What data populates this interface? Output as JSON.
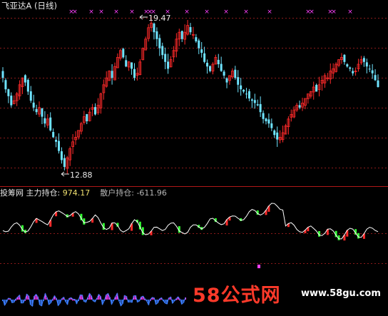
{
  "window": {
    "title": "飞亚达A (日线)"
  },
  "price_panel": {
    "high_label": "19.47",
    "low_label": "12.88",
    "colors": {
      "up": "#ff2a2a",
      "down": "#6fe4ff",
      "marker": "#ff40ff",
      "grid": "#8a1a1a",
      "line": "#ffffff"
    }
  },
  "indicator": {
    "name": "投筹网",
    "main_label": "主力持仓:",
    "main_value": "974.17",
    "retail_label": "散户持仓:",
    "retail_value": "-611.96",
    "colors": {
      "main_up": "#ff2a2a",
      "main_down": "#33ff33",
      "retail_up": "#ff40ff",
      "retail_down": "#3a7dff"
    }
  },
  "watermark": {
    "brand": "58公式网",
    "url": "www.58gu.com"
  },
  "chart_data": {
    "type": "candlestick",
    "title": "飞亚达A (日线)",
    "labeled_points": [
      {
        "label": "high",
        "value": 19.47
      },
      {
        "label": "low",
        "value": 12.88
      }
    ],
    "ylim": [
      12.5,
      20.0
    ],
    "close": [
      16.9,
      16.4,
      16.1,
      15.7,
      15.9,
      16.2,
      16.6,
      16.9,
      16.7,
      16.3,
      15.9,
      15.6,
      15.4,
      15.6,
      15.2,
      14.9,
      15.1,
      14.6,
      14.3,
      14.1,
      13.7,
      13.3,
      13.0,
      13.4,
      13.8,
      14.1,
      14.3,
      14.6,
      14.9,
      15.2,
      15.0,
      15.4,
      15.6,
      15.3,
      15.7,
      16.2,
      16.6,
      16.9,
      17.2,
      16.9,
      17.4,
      17.8,
      18.1,
      17.8,
      17.4,
      17.6,
      17.3,
      16.9,
      17.1,
      17.6,
      18.2,
      18.6,
      19.1,
      19.3,
      18.9,
      18.6,
      18.2,
      17.9,
      17.6,
      17.3,
      17.7,
      18.1,
      18.6,
      18.9,
      18.6,
      18.9,
      19.2,
      18.9,
      18.8,
      18.5,
      18.2,
      18.0,
      17.6,
      17.4,
      17.2,
      17.5,
      17.8,
      17.5,
      17.2,
      17.0,
      16.7,
      17.0,
      17.2,
      16.9,
      16.6,
      16.4,
      16.3,
      16.2,
      16.0,
      15.9,
      15.8,
      15.7,
      15.4,
      15.1,
      15.0,
      14.9,
      14.7,
      14.4,
      14.2,
      14.3,
      14.5,
      14.8,
      15.1,
      15.3,
      15.5,
      15.7,
      15.6,
      15.8,
      16.0,
      16.2,
      16.3,
      16.5,
      16.3,
      16.6,
      16.8,
      17.0,
      16.9,
      17.2,
      17.3,
      17.5,
      17.7,
      17.8,
      17.6,
      17.4,
      17.3,
      17.1,
      17.2,
      17.5,
      17.7,
      17.6,
      17.4,
      17.3,
      17.1,
      16.8,
      16.5
    ],
    "indicator_series": [
      {
        "name": "主力持仓",
        "last_value": 974.17
      },
      {
        "name": "散户持仓",
        "last_value": -611.96
      }
    ]
  }
}
